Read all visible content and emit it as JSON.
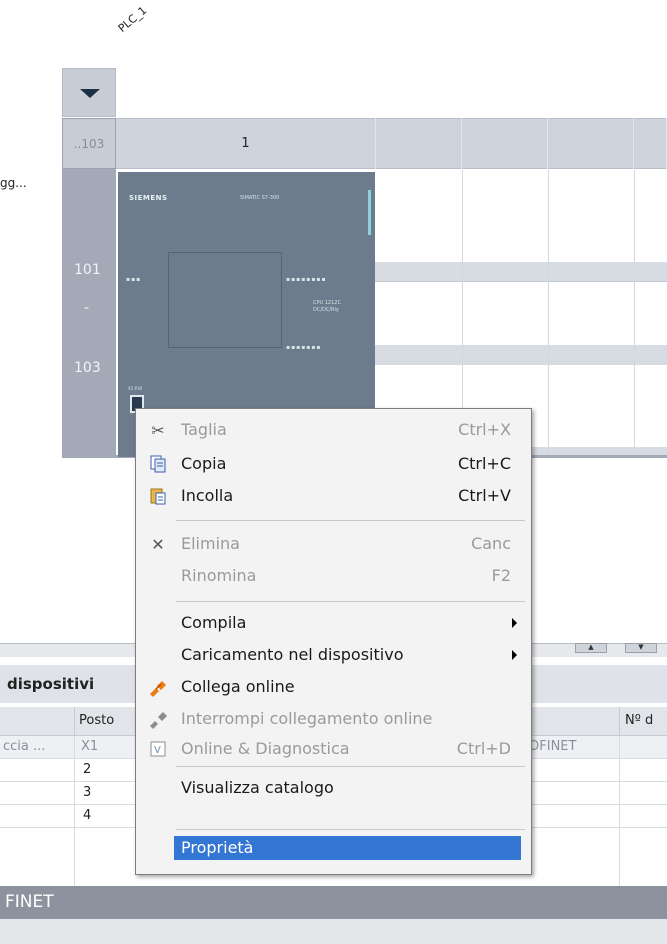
{
  "rack": {
    "plc_label": "PLC_1",
    "header_slot_range": "..103",
    "header_slot": "1",
    "row_label": "gg...",
    "row_num_top": "101",
    "row_num_mid": "-",
    "row_num_bottom": "103"
  },
  "module": {
    "brand": "SIEMENS",
    "model": "SIMATIC S7-300",
    "cpu_line1": "CPU 1212C",
    "cpu_line2": "DC/DC/Rly",
    "port_label": "X1 P1R"
  },
  "context_menu": {
    "items": [
      {
        "icon": "scissors-icon",
        "label": "Taglia",
        "shortcut": "Ctrl+X",
        "disabled": true
      },
      {
        "icon": "copy-icon",
        "label": "Copia",
        "shortcut": "Ctrl+C",
        "disabled": false
      },
      {
        "icon": "paste-icon",
        "label": "Incolla",
        "shortcut": "Ctrl+V",
        "disabled": false
      },
      {
        "icon": "delete-x-icon",
        "label": "Elimina",
        "shortcut": "Canc",
        "disabled": true
      },
      {
        "icon": "",
        "label": "Rinomina",
        "shortcut": "F2",
        "disabled": true
      },
      {
        "icon": "",
        "label": "Compila",
        "shortcut": "",
        "submenu": true,
        "disabled": false
      },
      {
        "icon": "",
        "label": "Caricamento nel dispositivo",
        "shortcut": "",
        "submenu": true,
        "disabled": false
      },
      {
        "icon": "go-online-icon",
        "label": "Collega online",
        "shortcut": "",
        "disabled": false
      },
      {
        "icon": "go-offline-icon",
        "label": "Interrompi collegamento online",
        "shortcut": "",
        "disabled": true
      },
      {
        "icon": "diagnostics-icon",
        "label": "Online & Diagnostica",
        "shortcut": "Ctrl+D",
        "disabled": true
      },
      {
        "icon": "",
        "label": "Visualizza catalogo",
        "shortcut": "",
        "disabled": false
      },
      {
        "icon": "",
        "label": "Proprietà",
        "shortcut": "",
        "disabled": false,
        "selected": true
      }
    ]
  },
  "device_overview": {
    "title": "dispositivi",
    "columns": [
      "Posto",
      "Nº d"
    ],
    "rows": [
      {
        "module": "ccia ...",
        "slot": "X1",
        "type": "ROFINET"
      },
      {
        "module": "",
        "slot": "2",
        "type": ""
      },
      {
        "module": "",
        "slot": "3",
        "type": ""
      },
      {
        "module": "",
        "slot": "4",
        "type": ""
      }
    ]
  },
  "properties_bar": {
    "title": "FINET"
  },
  "colors": {
    "menu_highlight": "#3376d3",
    "rack_column": "#a3a9b7",
    "module_body": "#6c7c8c"
  }
}
